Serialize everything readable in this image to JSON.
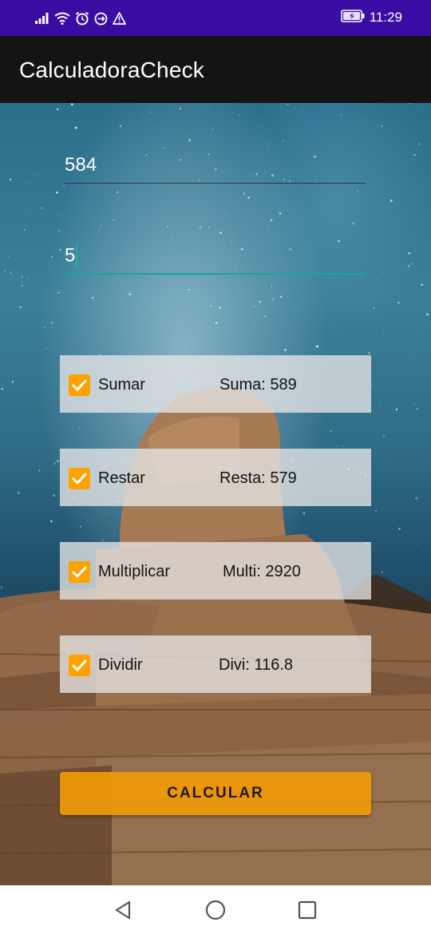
{
  "status_bar": {
    "time": "11:29",
    "icons": [
      "signal-icon",
      "wifi-icon",
      "alarm-icon",
      "sync-icon",
      "warning-icon",
      "battery-charging-icon"
    ]
  },
  "app_bar": {
    "title": "CalculadoraCheck"
  },
  "inputs": {
    "first_value": "584",
    "second_value": "5"
  },
  "operations": [
    {
      "label": "Sumar",
      "checked": true,
      "result": "Suma: 589"
    },
    {
      "label": "Restar",
      "checked": true,
      "result": "Resta: 579"
    },
    {
      "label": "Multiplicar",
      "checked": true,
      "result": "Multi: 2920"
    },
    {
      "label": "Dividir",
      "checked": true,
      "result": "Divi: 116.8"
    }
  ],
  "button": {
    "label": "CALCULAR"
  },
  "nav_bar": {
    "icons": [
      "back-icon",
      "home-icon",
      "recents-icon"
    ]
  },
  "colors": {
    "status_bar": "#3a0ca3",
    "app_bar": "#141414",
    "accent": "#ffa200",
    "field_focus": "#13a89e"
  }
}
